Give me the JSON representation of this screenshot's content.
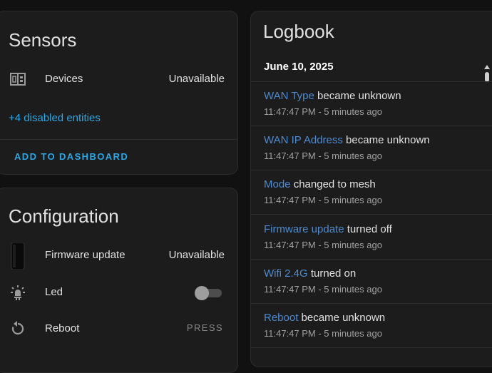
{
  "sensors": {
    "title": "Sensors",
    "devices": {
      "label": "Devices",
      "value": "Unavailable",
      "icon": "devices-counter-icon"
    },
    "disabled_link": "+4 disabled entities",
    "add_button": "ADD TO DASHBOARD"
  },
  "configuration": {
    "title": "Configuration",
    "firmware": {
      "label": "Firmware update",
      "value": "Unavailable",
      "icon": "router-device-icon"
    },
    "led": {
      "label": "Led",
      "icon": "led-bulb-icon",
      "toggle_on": false
    },
    "reboot": {
      "label": "Reboot",
      "button": "PRESS",
      "icon": "restart-icon"
    }
  },
  "logbook": {
    "title": "Logbook",
    "date": "June 10, 2025",
    "entries": [
      {
        "entity": "WAN Type",
        "action": " became unknown",
        "time": "11:47:47 PM - 5 minutes ago"
      },
      {
        "entity": "WAN IP Address",
        "action": " became unknown",
        "time": "11:47:47 PM - 5 minutes ago"
      },
      {
        "entity": "Mode",
        "action": " changed to mesh",
        "time": "11:47:47 PM - 5 minutes ago"
      },
      {
        "entity": "Firmware update",
        "action": " turned off",
        "time": "11:47:47 PM - 5 minutes ago"
      },
      {
        "entity": "Wifi 2.4G",
        "action": " turned on",
        "time": "11:47:47 PM - 5 minutes ago"
      },
      {
        "entity": "Reboot",
        "action": " became unknown",
        "time": "11:47:47 PM - 5 minutes ago"
      }
    ]
  },
  "colors": {
    "accent": "#2ea7e6",
    "entity_link": "#4d8ad0",
    "card_bg": "#1c1c1c",
    "page_bg": "#111111"
  }
}
